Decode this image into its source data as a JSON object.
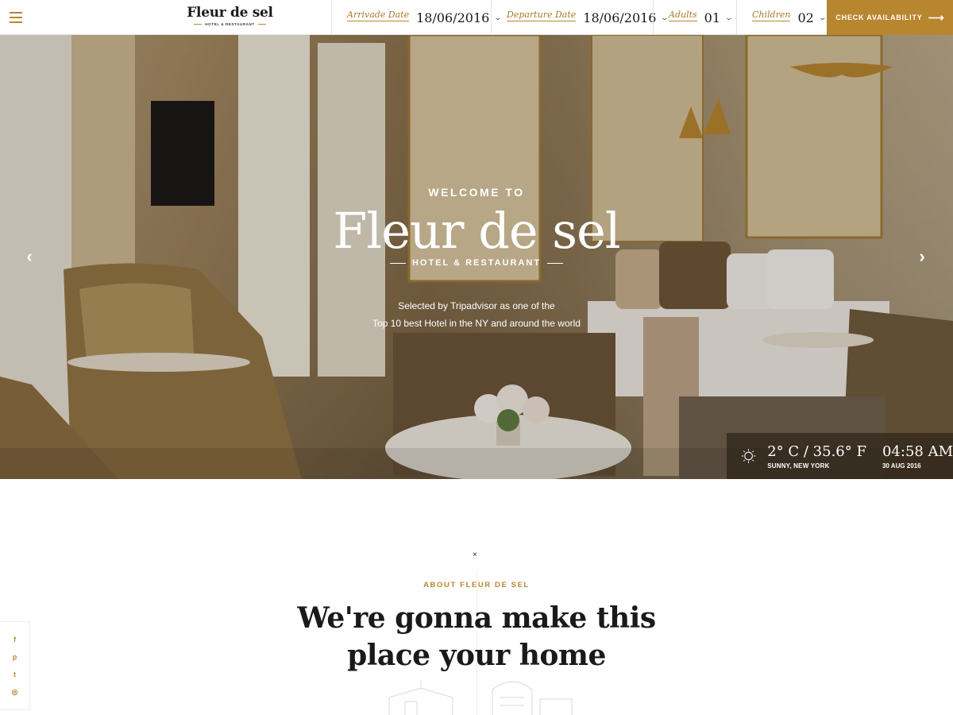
{
  "header": {
    "logo_name": "Fleur de sel",
    "logo_sub": "HOTEL & RESTAURANT",
    "booking": [
      {
        "label": "Arrivade Date",
        "value": "18/06/2016"
      },
      {
        "label": "Departure Date",
        "value": "18/06/2016"
      },
      {
        "label": "Adults",
        "value": "01"
      },
      {
        "label": "Children",
        "value": "02"
      }
    ],
    "check_label": "CHECK AVAILABILITY",
    "check_arrow": "⟶"
  },
  "hero": {
    "welcome": "WELCOME TO",
    "title": "Fleur de sel",
    "subtitle": "HOTEL & RESTAURANT",
    "desc_line1": "Selected by Tripadvisor as one of the",
    "desc_line2": "Top 10 best Hotel in the NY and around the world",
    "prev_icon": "‹",
    "next_icon": "›"
  },
  "weather": {
    "icon": "sun-icon",
    "temp": "2° C / 35.6° F",
    "location": "SUNNY, NEW YORK",
    "time": "04:58 AM",
    "date": "30 AUG 2016"
  },
  "about": {
    "close": "×",
    "label": "ABOUT FLEUR DE SEL",
    "title_line1": "We're gonna make this",
    "title_line2": "place your home"
  },
  "social": {
    "facebook": "f",
    "pinterest": "p",
    "twitter": "t",
    "instagram": "◎"
  },
  "colors": {
    "accent": "#b8862f",
    "dark": "#1a1a1a"
  }
}
